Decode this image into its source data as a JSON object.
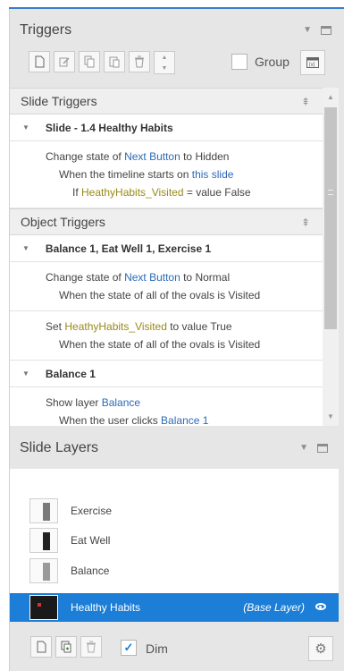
{
  "triggers_panel": {
    "title": "Triggers",
    "group_label": "Group"
  },
  "slide_triggers": {
    "header": "Slide Triggers",
    "group_title": "Slide - 1.4 Healthy Habits",
    "items": [
      {
        "action_pre": "Change state of ",
        "action_obj": "Next Button",
        "action_mid": " to ",
        "action_val": "Hidden",
        "when_pre": "When the timeline starts on ",
        "when_obj": "this slide",
        "cond_obj": "HeathyHabits_Visited",
        "cond_mid": " = value ",
        "cond_val": "False"
      }
    ]
  },
  "object_triggers": {
    "header": "Object Triggers",
    "groups": [
      {
        "title": "Balance 1, Eat Well 1, Exercise 1",
        "items": [
          {
            "action_pre": "Change state of ",
            "action_obj": "Next Button",
            "action_mid": " to ",
            "action_val": "Normal",
            "when": "When the state of all of the ovals is Visited"
          },
          {
            "action_pre": "Set ",
            "action_obj": "HeathyHabits_Visited",
            "action_mid": " to value ",
            "action_val": "True",
            "when": "When the state of all of the ovals is Visited"
          }
        ]
      },
      {
        "title": "Balance 1",
        "items": [
          {
            "action_pre": "Show layer ",
            "action_obj": "Balance",
            "when_pre": "When the user clicks ",
            "when_obj": "Balance 1"
          }
        ]
      }
    ]
  },
  "slide_layers": {
    "title": "Slide Layers",
    "layers": [
      {
        "name": "Exercise"
      },
      {
        "name": "Eat Well"
      },
      {
        "name": "Balance"
      },
      {
        "name": "Healthy Habits",
        "tag": "(Base Layer)",
        "selected": true
      }
    ],
    "dim_label": "Dim",
    "dim_checked": true
  },
  "colors": {
    "accent": "#1c7ed6",
    "link": "#2a6ab8",
    "variable": "#9a8a18"
  }
}
